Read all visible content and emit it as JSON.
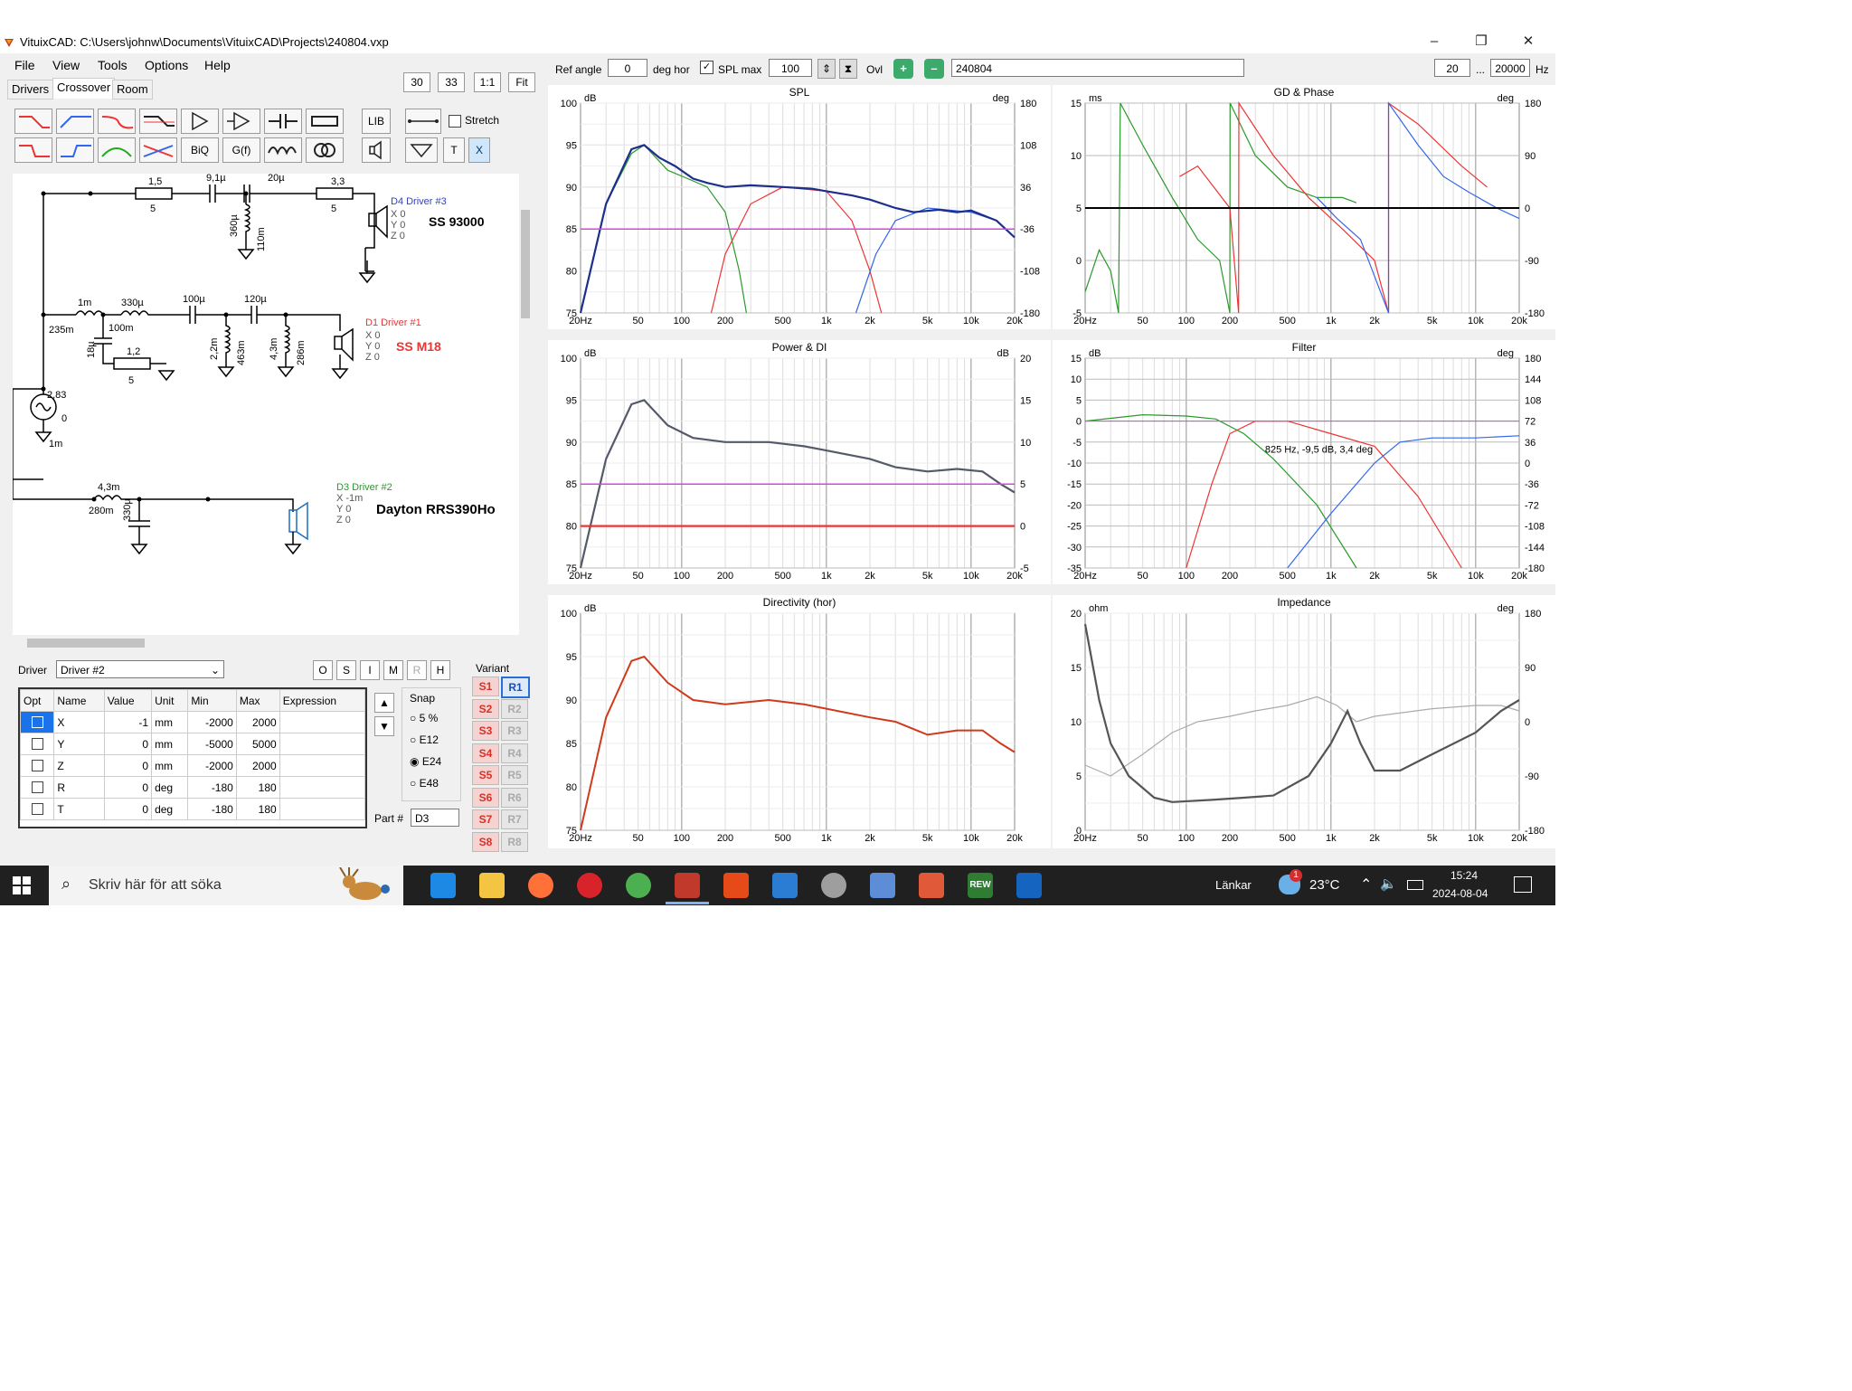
{
  "window": {
    "title": "VituixCAD: C:\\Users\\johnw\\Documents\\VituixCAD\\Projects\\240804.vxp",
    "controls": [
      "–",
      "❐",
      "✕"
    ]
  },
  "menu": [
    "File",
    "View",
    "Tools",
    "Options",
    "Help"
  ],
  "tabs": [
    "Drivers",
    "Crossover",
    "Room"
  ],
  "zoom_buttons": [
    "30",
    "33",
    "1:1",
    "Fit"
  ],
  "toolbar_text": {
    "biq": "BiQ",
    "gf": "G(f)",
    "lib": "LIB",
    "t": "T",
    "x": "X",
    "stretch": "Stretch"
  },
  "schematic": {
    "top_branch": {
      "r1": "1,5",
      "r1b": "5",
      "c1": "9,1µ",
      "c2": "20µ",
      "r2": "3,3",
      "r2b": "5",
      "l_shunt": "360µ",
      "l_shunt_r": "110m",
      "driver": "D4 Driver #3",
      "xyz": [
        "X 0",
        "Y 0",
        "Z 0"
      ],
      "name": "SS 93000"
    },
    "mid_branch": {
      "l1": "1m",
      "l1r": "235m",
      "l2": "330µ",
      "l2r": "100m",
      "c1": "100µ",
      "c2": "120µ",
      "c3": "18µ",
      "r": "1,2",
      "rb": "5",
      "l3": "2,2m",
      "l3r": "463m",
      "l4": "4,3m",
      "l4r": "286m",
      "driver": "D1 Driver #1",
      "xyz": [
        "X 0",
        "Y 0",
        "Z 0"
      ],
      "name": "SS M18"
    },
    "source": {
      "v": "2,83",
      "phase": "0",
      "r": "1m"
    },
    "low_branch": {
      "l": "4,3m",
      "lr": "280m",
      "c": "330µ",
      "driver": "D3 Driver #2",
      "xyz": [
        "X -1m",
        "Y 0",
        "Z 0"
      ],
      "name": "Dayton RRS390Ho"
    }
  },
  "driver_select": {
    "label": "Driver",
    "value": "Driver #2"
  },
  "osim_buttons": [
    "O",
    "S",
    "I",
    "M",
    "R",
    "H"
  ],
  "param_table": {
    "headers": [
      "Opt",
      "Name",
      "Value",
      "Unit",
      "Min",
      "Max",
      "Expression"
    ],
    "rows": [
      [
        "X",
        "-1",
        "mm",
        "-2000",
        "2000"
      ],
      [
        "Y",
        "0",
        "mm",
        "-5000",
        "5000"
      ],
      [
        "Z",
        "0",
        "mm",
        "-2000",
        "2000"
      ],
      [
        "R",
        "0",
        "deg",
        "-180",
        "180"
      ],
      [
        "T",
        "0",
        "deg",
        "-180",
        "180"
      ]
    ]
  },
  "snap": {
    "label": "Snap",
    "options": [
      "5 %",
      "E12",
      "E24",
      "E48"
    ],
    "selected": "E24"
  },
  "part": {
    "label": "Part #",
    "value": "D3"
  },
  "variant": {
    "label": "Variant",
    "s": [
      "S1",
      "S2",
      "S3",
      "S4",
      "S5",
      "S6",
      "S7",
      "S8"
    ],
    "r": [
      "R1",
      "R2",
      "R3",
      "R4",
      "R5",
      "R6",
      "R7",
      "R8"
    ]
  },
  "topbar": {
    "ref_angle_label": "Ref angle",
    "ref_angle": "0",
    "deg_hor": "deg hor",
    "spl_max_label": "SPL max",
    "spl_max": "100",
    "ovl": "Ovl",
    "name": "240804",
    "f_min": "20",
    "dots": "...",
    "f_max": "20000",
    "hz": "Hz"
  },
  "freq_ticks": [
    "20Hz",
    "50",
    "100",
    "200",
    "500",
    "1k",
    "2k",
    "5k",
    "10k",
    "20k"
  ],
  "charts": {
    "spl": {
      "title": "SPL",
      "left_unit": "dB",
      "right_unit": "deg",
      "left_ticks": [
        "100",
        "95",
        "90",
        "85",
        "80",
        "75"
      ],
      "right_ticks": [
        "180",
        "108",
        "36",
        "-36",
        "-108",
        "-180"
      ]
    },
    "gd": {
      "title": "GD & Phase",
      "left_unit": "ms",
      "right_unit": "deg",
      "left_ticks": [
        "15",
        "10",
        "5",
        "0",
        "-5"
      ],
      "right_ticks": [
        "180",
        "90",
        "0",
        "-90",
        "-180"
      ]
    },
    "power": {
      "title": "Power & DI",
      "left_unit": "dB",
      "right_unit": "dB",
      "left_ticks": [
        "100",
        "95",
        "90",
        "85",
        "80",
        "75"
      ],
      "right_ticks": [
        "20",
        "15",
        "10",
        "5",
        "0",
        "-5"
      ]
    },
    "filter": {
      "title": "Filter",
      "left_unit": "dB",
      "right_unit": "deg",
      "left_ticks": [
        "15",
        "10",
        "5",
        "0",
        "-5",
        "-10",
        "-15",
        "-20",
        "-25",
        "-30",
        "-35"
      ],
      "right_ticks": [
        "180",
        "144",
        "108",
        "72",
        "36",
        "0",
        "-36",
        "-72",
        "-108",
        "-144",
        "-180"
      ],
      "cursor_label": "825 Hz, -9,5 dB, 3,4 deg"
    },
    "directivity": {
      "title": "Directivity (hor)",
      "left_unit": "dB",
      "left_ticks": [
        "100",
        "95",
        "90",
        "85",
        "80",
        "75"
      ]
    },
    "impedance": {
      "title": "Impedance",
      "left_unit": "ohm",
      "right_unit": "deg",
      "left_ticks": [
        "20",
        "15",
        "10",
        "5",
        "0"
      ],
      "right_ticks": [
        "180",
        "90",
        "0",
        "-90",
        "-180"
      ]
    }
  },
  "taskbar": {
    "search": "Skriv här för att söka",
    "links": "Länkar",
    "temp": "23°C",
    "time": "15:24",
    "date": "2024-08-04",
    "notif": "1",
    "rew": "REW"
  }
}
